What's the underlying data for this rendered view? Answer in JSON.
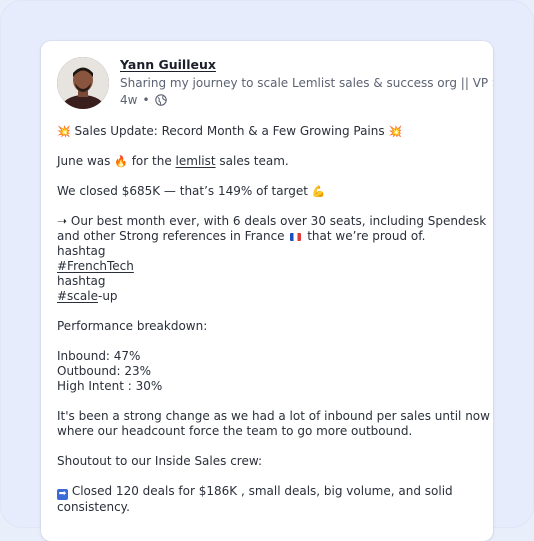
{
  "post": {
    "author": "Yann Guilleux",
    "headline": "Sharing my journey to scale Lemlist sales & success org || VP S",
    "time": "4w",
    "bullet": "•",
    "visibility_icon": "globe-icon",
    "lines": {
      "l1_em1": "💥",
      "l1_text": " Sales Update: Record Month & a Few Growing Pains ",
      "l1_em2": "💥",
      "l2_a": "June was ",
      "l2_em": "🔥",
      "l2_b": " for the ",
      "l2_link": "lemlist",
      "l2_c": " sales team.",
      "l3_a": "We closed $685K — that’s 149% of target ",
      "l3_em": "💪",
      "l4": " ➝ Our best month ever, with 6 deals over 30 seats, including Spendesk",
      "l5_a": "and other Strong references in France ",
      "l5_b": " that we’re proud of.",
      "l6": "hashtag",
      "l7_link": "#FrenchTech",
      "l8": "hashtag",
      "l9_link": "#scale",
      "l9_b": "-up",
      "l10": "Performance breakdown:",
      "l11": "Inbound: 47%",
      "l12": "Outbound: 23%",
      "l13": "High Intent : 30%",
      "l14": "It's been a strong change as we had a lot of inbound per sales until now",
      "l15": "where our headcount force the team to go more outbound.",
      "l16": "Shoutout to our Inside Sales crew:",
      "l17_icon": "➡",
      "l17": " Closed 120 deals for $186K , small deals, big volume, and solid",
      "l18": "consistency."
    }
  },
  "colors": {
    "background": "#e9eefb",
    "card": "#ffffff",
    "text": "#2a2f3a",
    "muted": "#5b6272"
  }
}
